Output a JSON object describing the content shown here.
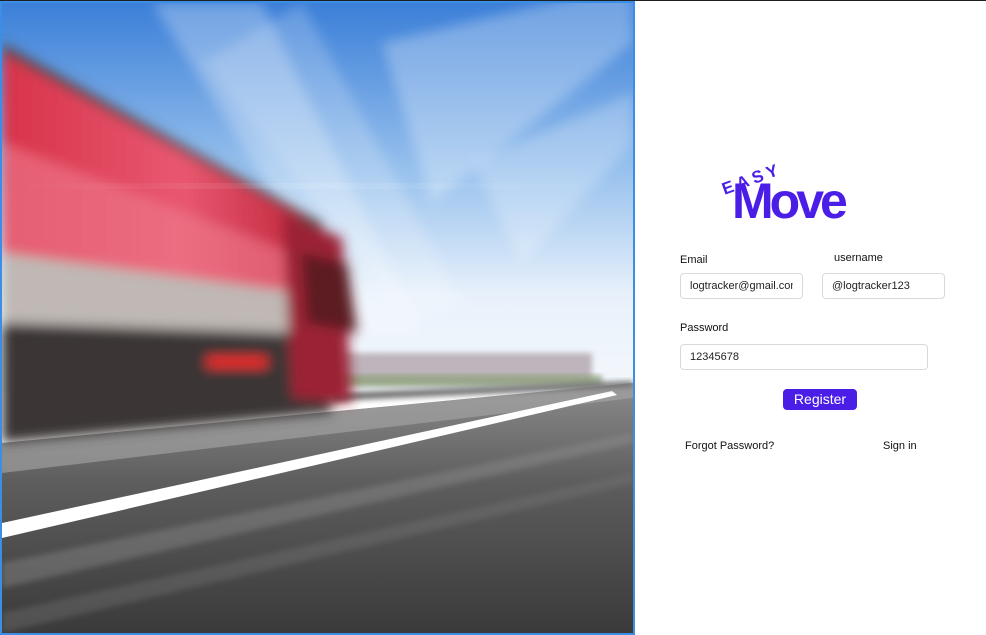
{
  "brand": {
    "logo_top": "EASY",
    "logo_main": "Move",
    "color": "#4b1ee8"
  },
  "form": {
    "email": {
      "label": "Email",
      "value": "logtracker@gmail.com"
    },
    "username": {
      "label": "username",
      "value": "@logtracker123"
    },
    "password": {
      "label": "Password",
      "value": "12345678"
    },
    "register_label": "Register",
    "forgot_label": "Forgot Password?",
    "signin_label": "Sign in"
  },
  "hero": {
    "subject": "truck-on-highway-photo"
  }
}
